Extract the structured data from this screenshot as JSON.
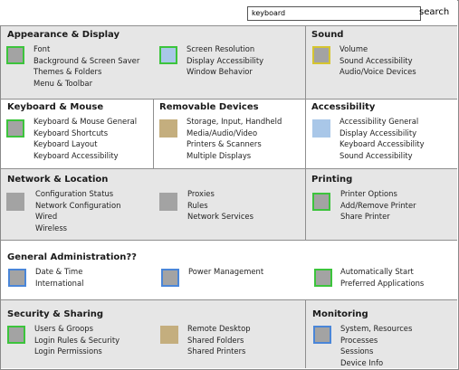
{
  "search": {
    "value": "keyboard",
    "button_label": "search"
  },
  "colors": {
    "row_gray": "#e6e6e6",
    "row_white": "#ffffff",
    "divider": "#8f8f8f",
    "icon_fill": "#a3a3a3",
    "icon_border_green": "#3cc43c",
    "icon_border_blue": "#4a86d8",
    "icon_border_yellow": "#d6c530",
    "icon_fill_tan": "#c4ae7e",
    "icon_fill_lightblue": "#a9c7e8"
  },
  "sections": {
    "appearance": {
      "title": "Appearance & Display",
      "col1": [
        "Font",
        "Background & Screen Saver",
        "Themes & Folders",
        "Menu & Toolbar"
      ],
      "col2": [
        "Screen Resolution",
        "Display Accessibility",
        "Window Behavior"
      ]
    },
    "sound": {
      "title": "Sound",
      "items": [
        "Volume",
        "Sound Accessibility",
        "Audio/Voice Devices"
      ]
    },
    "keyboard_mouse": {
      "title": "Keyboard & Mouse",
      "items": [
        "Keyboard & Mouse General",
        "Keyboard Shortcuts",
        "Keyboard Layout",
        "Keyboard Accessibility"
      ]
    },
    "removable": {
      "title": "Removable Devices",
      "items": [
        "Storage, Input, Handheld",
        "Media/Audio/Video",
        "Printers & Scanners",
        "Multiple Displays"
      ]
    },
    "accessibility": {
      "title": "Accessibility",
      "items": [
        "Accessibility General",
        "Display Accessibility",
        "Keyboard Accessibility",
        "Sound Accessibility"
      ]
    },
    "network": {
      "title": "Network & Location",
      "col1": [
        "Configuration Status",
        "Network Configuration",
        "Wired",
        "Wireless"
      ],
      "col2": [
        "Proxies",
        "Rules",
        "Network Services"
      ]
    },
    "printing": {
      "title": "Printing",
      "items": [
        "Printer Options",
        "Add/Remove Printer",
        "Share Printer"
      ]
    },
    "general_admin": {
      "title": "General Administration??",
      "col1": [
        "Date & Time",
        "International"
      ],
      "col2": [
        "Power Management"
      ],
      "col3": [
        "Automatically Start",
        "Preferred Applications"
      ]
    },
    "security": {
      "title": "Security & Sharing",
      "col1": [
        "Users & Groops",
        "Login Rules & Security",
        "Login Permissions"
      ],
      "col2": [
        "Remote Desktop",
        "Shared Folders",
        "Shared Printers"
      ]
    },
    "monitoring": {
      "title": "Monitoring",
      "items": [
        "System, Resources",
        "Processes",
        "Sessions",
        "Device Info"
      ]
    }
  }
}
